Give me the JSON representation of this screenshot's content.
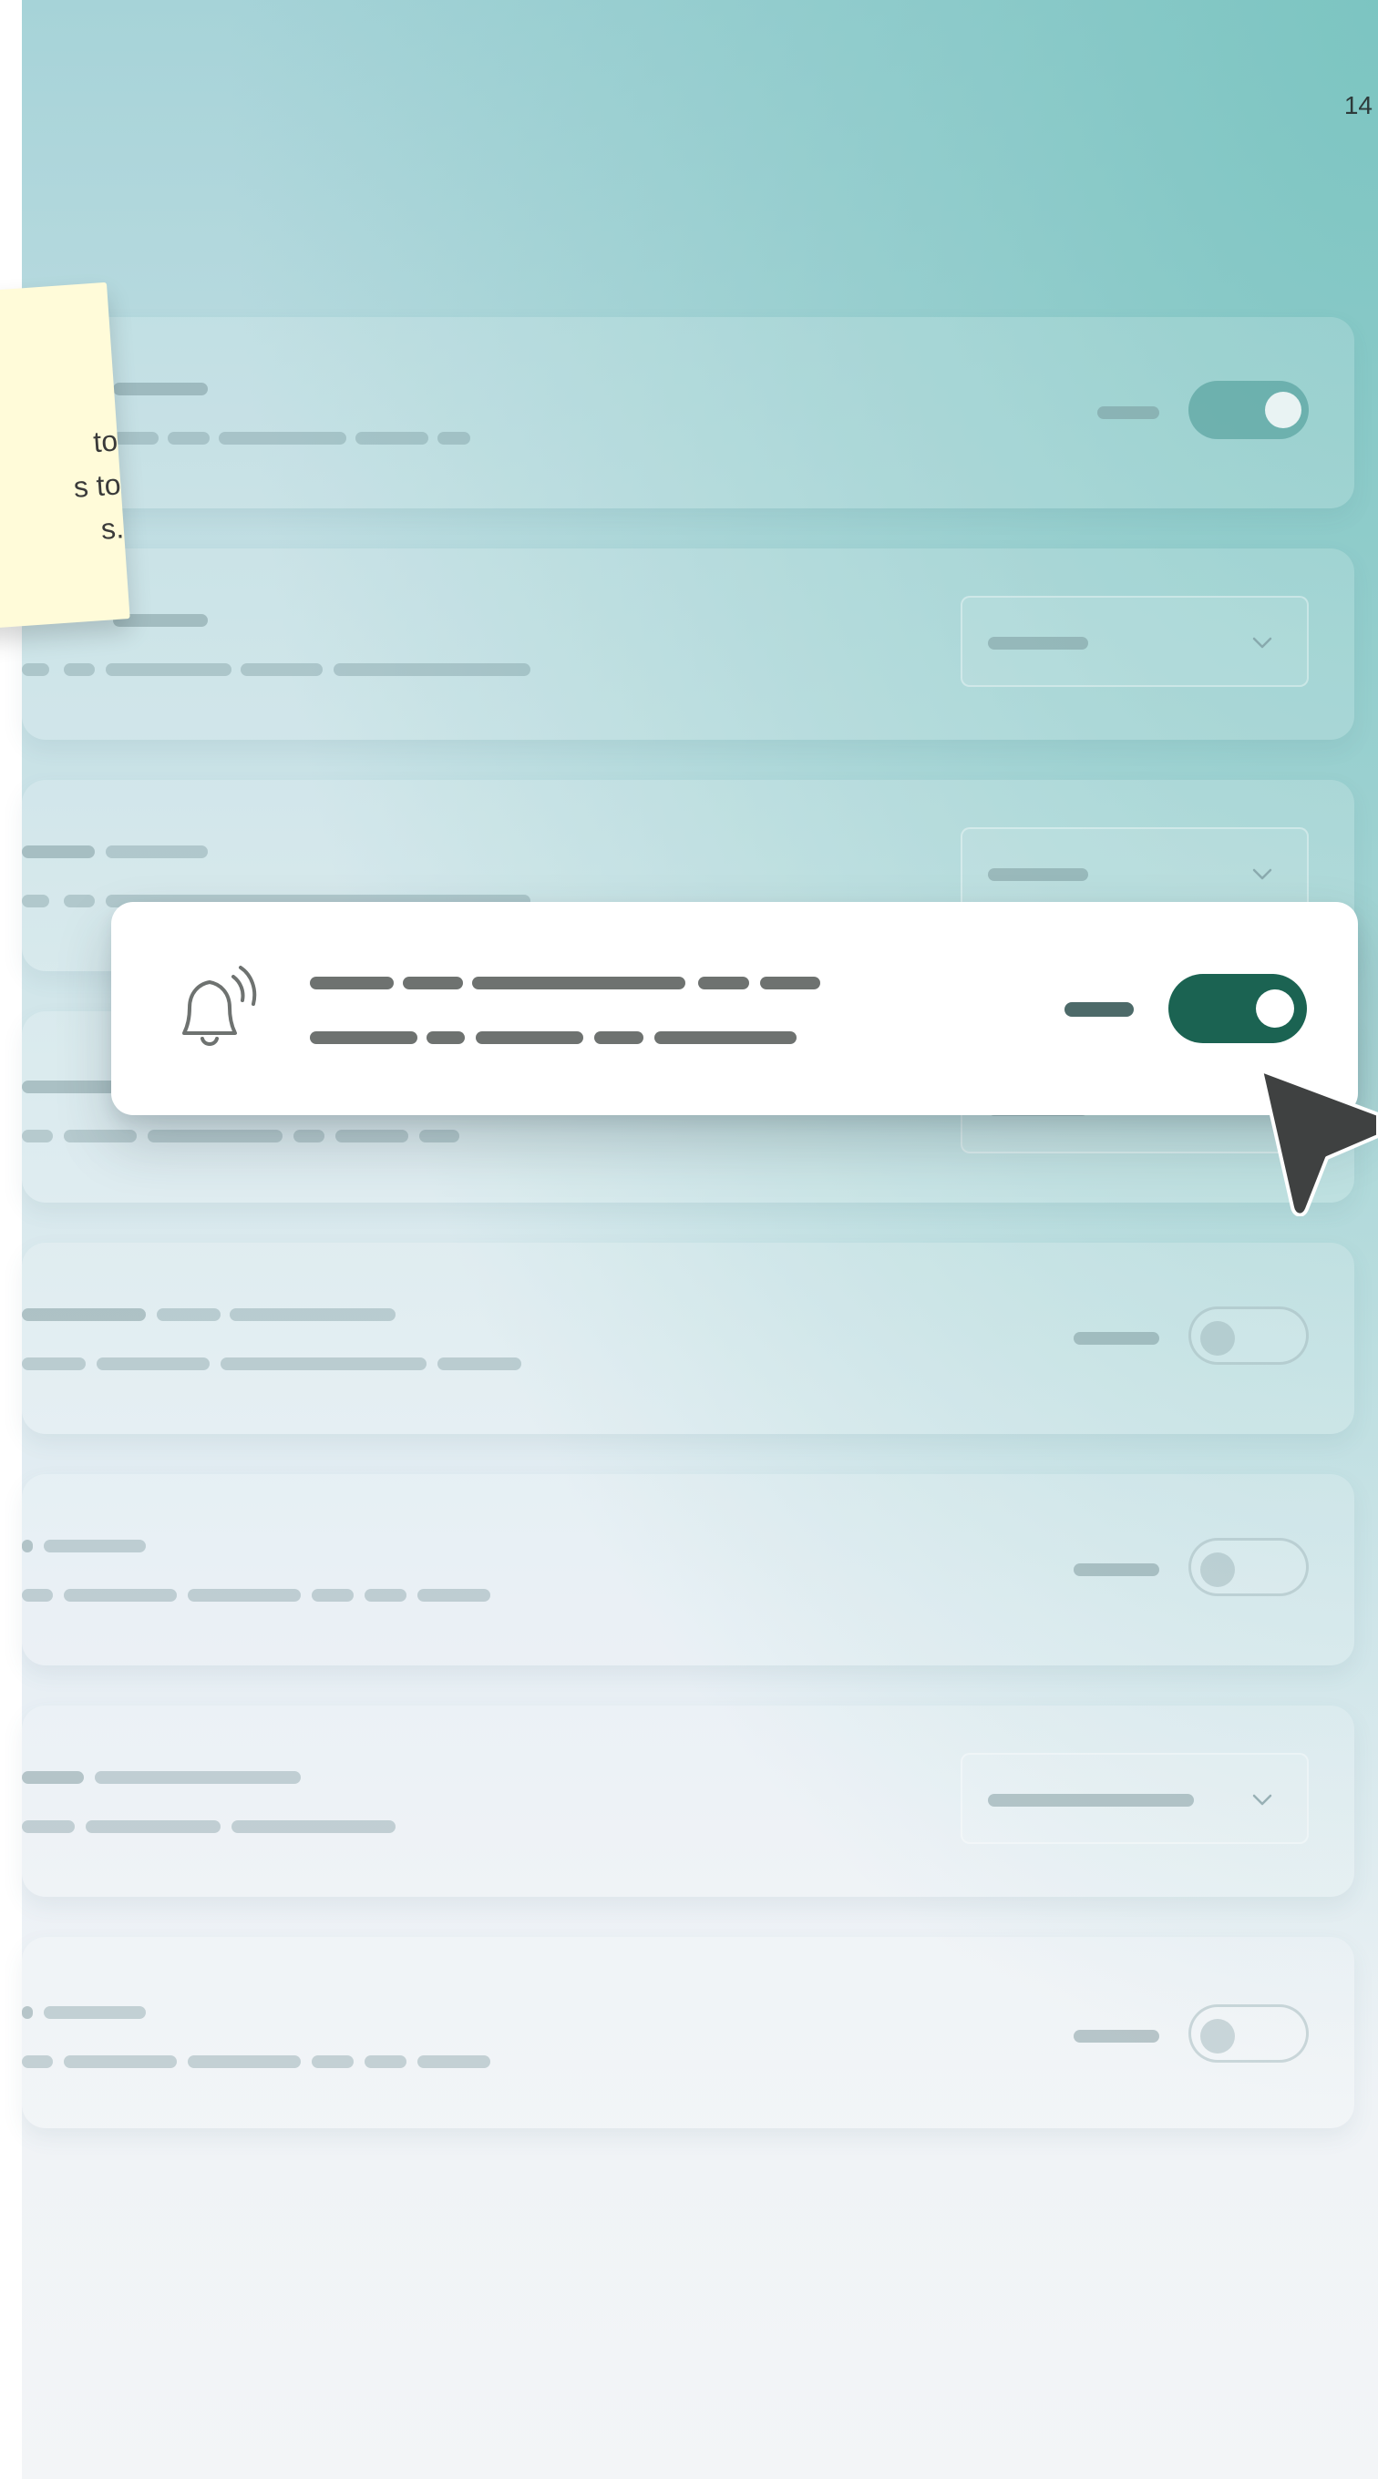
{
  "page": {
    "number": "14"
  },
  "sticky_note": {
    "text": "to\ns to\ns."
  },
  "settings": {
    "rows": [
      {
        "control": "toggle",
        "state": "on"
      },
      {
        "control": "select"
      },
      {
        "control": "select"
      },
      {
        "control": "select"
      },
      {
        "control": "toggle",
        "state": "off"
      },
      {
        "control": "toggle",
        "state": "off"
      },
      {
        "control": "select"
      },
      {
        "control": "toggle",
        "state": "off"
      }
    ]
  },
  "highlight_row": {
    "icon": "bell-icon",
    "control": "toggle",
    "state": "on"
  },
  "colors": {
    "accent": "#1b6352",
    "sticky_note": "#fffbd9",
    "background_top": "#a6d3d8",
    "background_bottom": "#f3f5f7"
  },
  "icons": [
    "bell-icon",
    "chevron-down-icon",
    "cursor-icon"
  ]
}
